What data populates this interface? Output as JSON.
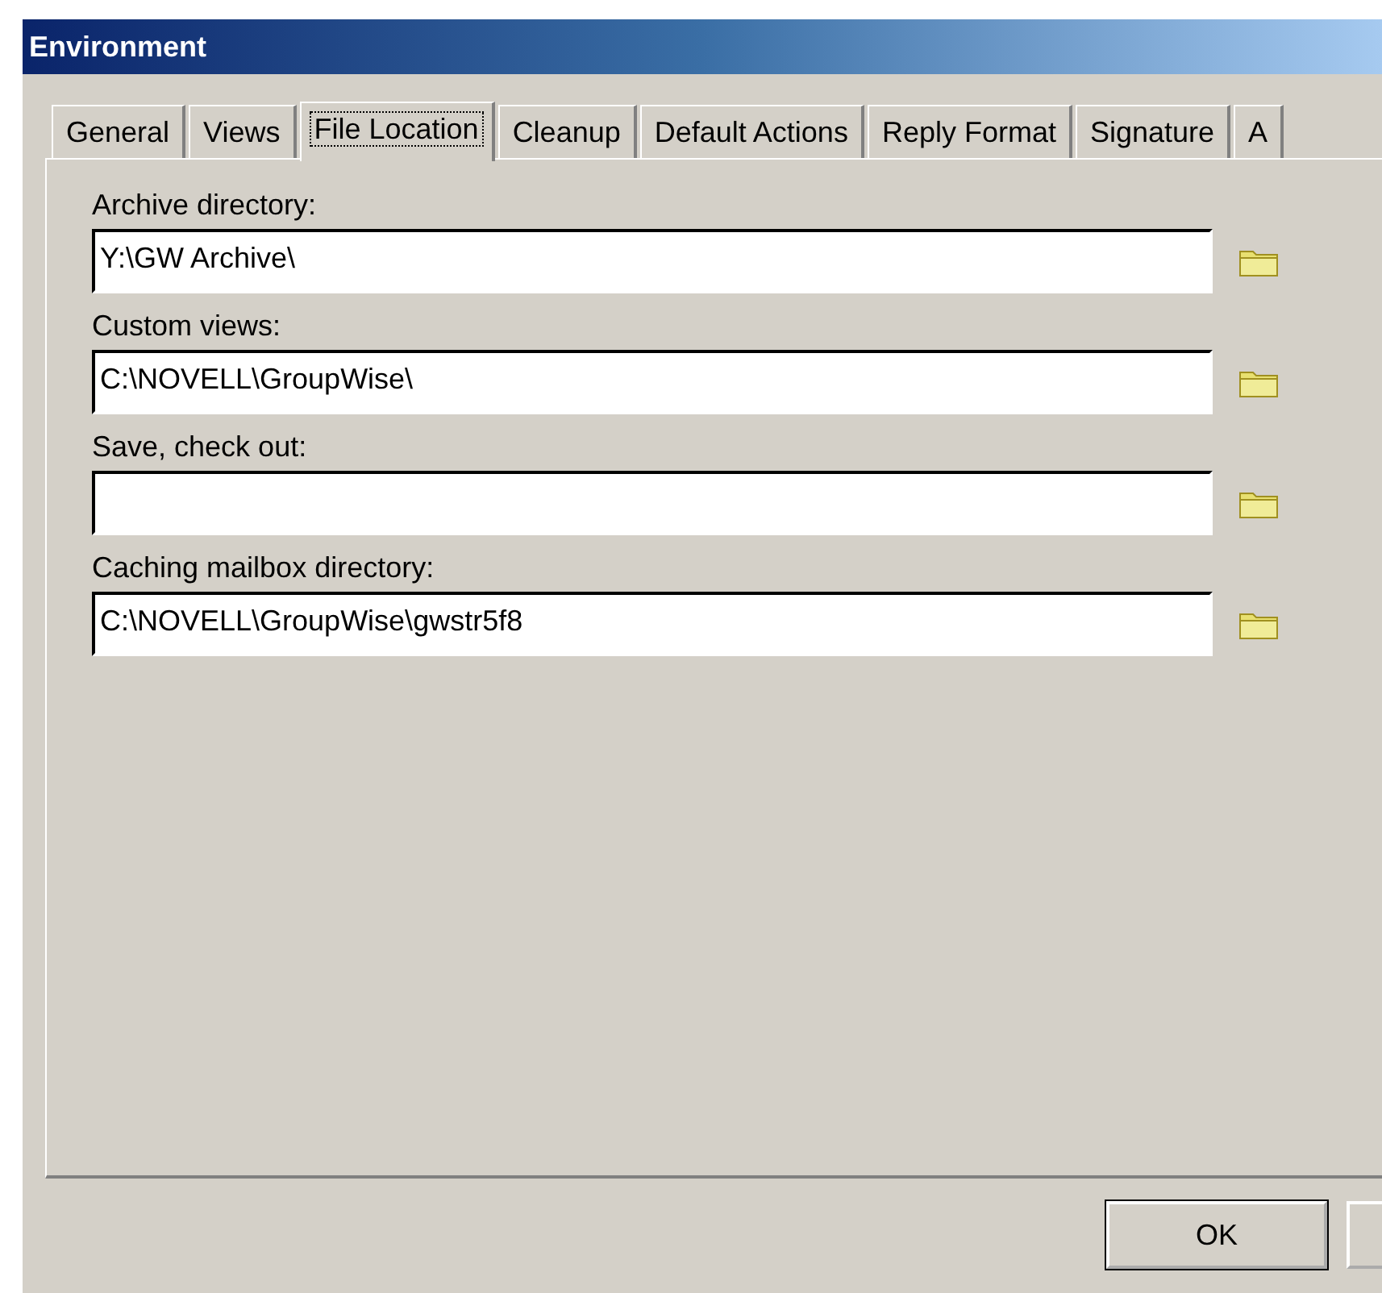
{
  "window": {
    "title": "Environment"
  },
  "tabs": [
    {
      "label": "General",
      "selected": false
    },
    {
      "label": "Views",
      "selected": false
    },
    {
      "label": "File Location",
      "selected": true
    },
    {
      "label": "Cleanup",
      "selected": false
    },
    {
      "label": "Default Actions",
      "selected": false
    },
    {
      "label": "Reply Format",
      "selected": false
    },
    {
      "label": "Signature",
      "selected": false
    },
    {
      "label": "A",
      "selected": false
    }
  ],
  "fields": [
    {
      "label": "Archive directory:",
      "value": "Y:\\GW Archive\\"
    },
    {
      "label": "Custom views:",
      "value": "C:\\NOVELL\\GroupWise\\"
    },
    {
      "label": "Save, check out:"
    },
    {
      "label": "Caching mailbox directory:",
      "value": "C:\\NOVELL\\GroupWise\\gwstr5f8"
    }
  ],
  "buttons": [
    {
      "kind": "default",
      "label": "OK"
    },
    {
      "kind": "cut_off"
    }
  ]
}
